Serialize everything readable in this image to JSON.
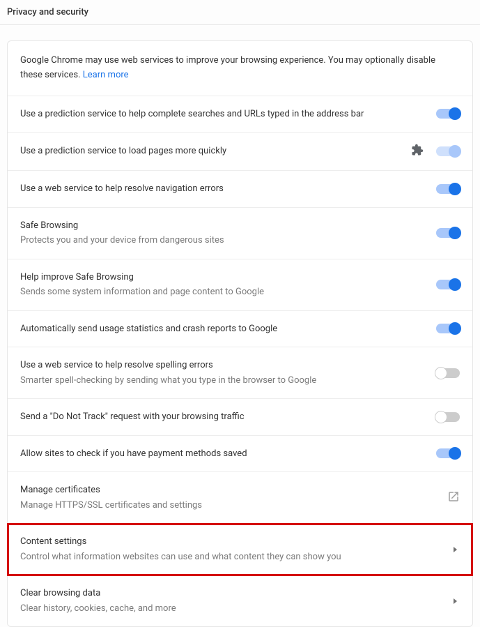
{
  "header": {
    "title": "Privacy and security"
  },
  "intro": {
    "text": "Google Chrome may use web services to improve your browsing experience. You may optionally disable these services. ",
    "learn_more": "Learn more"
  },
  "rows": {
    "prediction_search": {
      "title": "Use a prediction service to help complete searches and URLs typed in the address bar"
    },
    "prediction_pages": {
      "title": "Use a prediction service to load pages more quickly"
    },
    "nav_errors": {
      "title": "Use a web service to help resolve navigation errors"
    },
    "safe_browsing": {
      "title": "Safe Browsing",
      "sub": "Protects you and your device from dangerous sites"
    },
    "help_safe_browsing": {
      "title": "Help improve Safe Browsing",
      "sub": "Sends some system information and page content to Google"
    },
    "usage_stats": {
      "title": "Automatically send usage statistics and crash reports to Google"
    },
    "spelling": {
      "title": "Use a web service to help resolve spelling errors",
      "sub": "Smarter spell-checking by sending what you type in the browser to Google"
    },
    "dnt": {
      "title": "Send a \"Do Not Track\" request with your browsing traffic"
    },
    "payment": {
      "title": "Allow sites to check if you have payment methods saved"
    },
    "certificates": {
      "title": "Manage certificates",
      "sub": "Manage HTTPS/SSL certificates and settings"
    },
    "content": {
      "title": "Content settings",
      "sub": "Control what information websites can use and what content they can show you"
    },
    "clear": {
      "title": "Clear browsing data",
      "sub": "Clear history, cookies, cache, and more"
    }
  }
}
